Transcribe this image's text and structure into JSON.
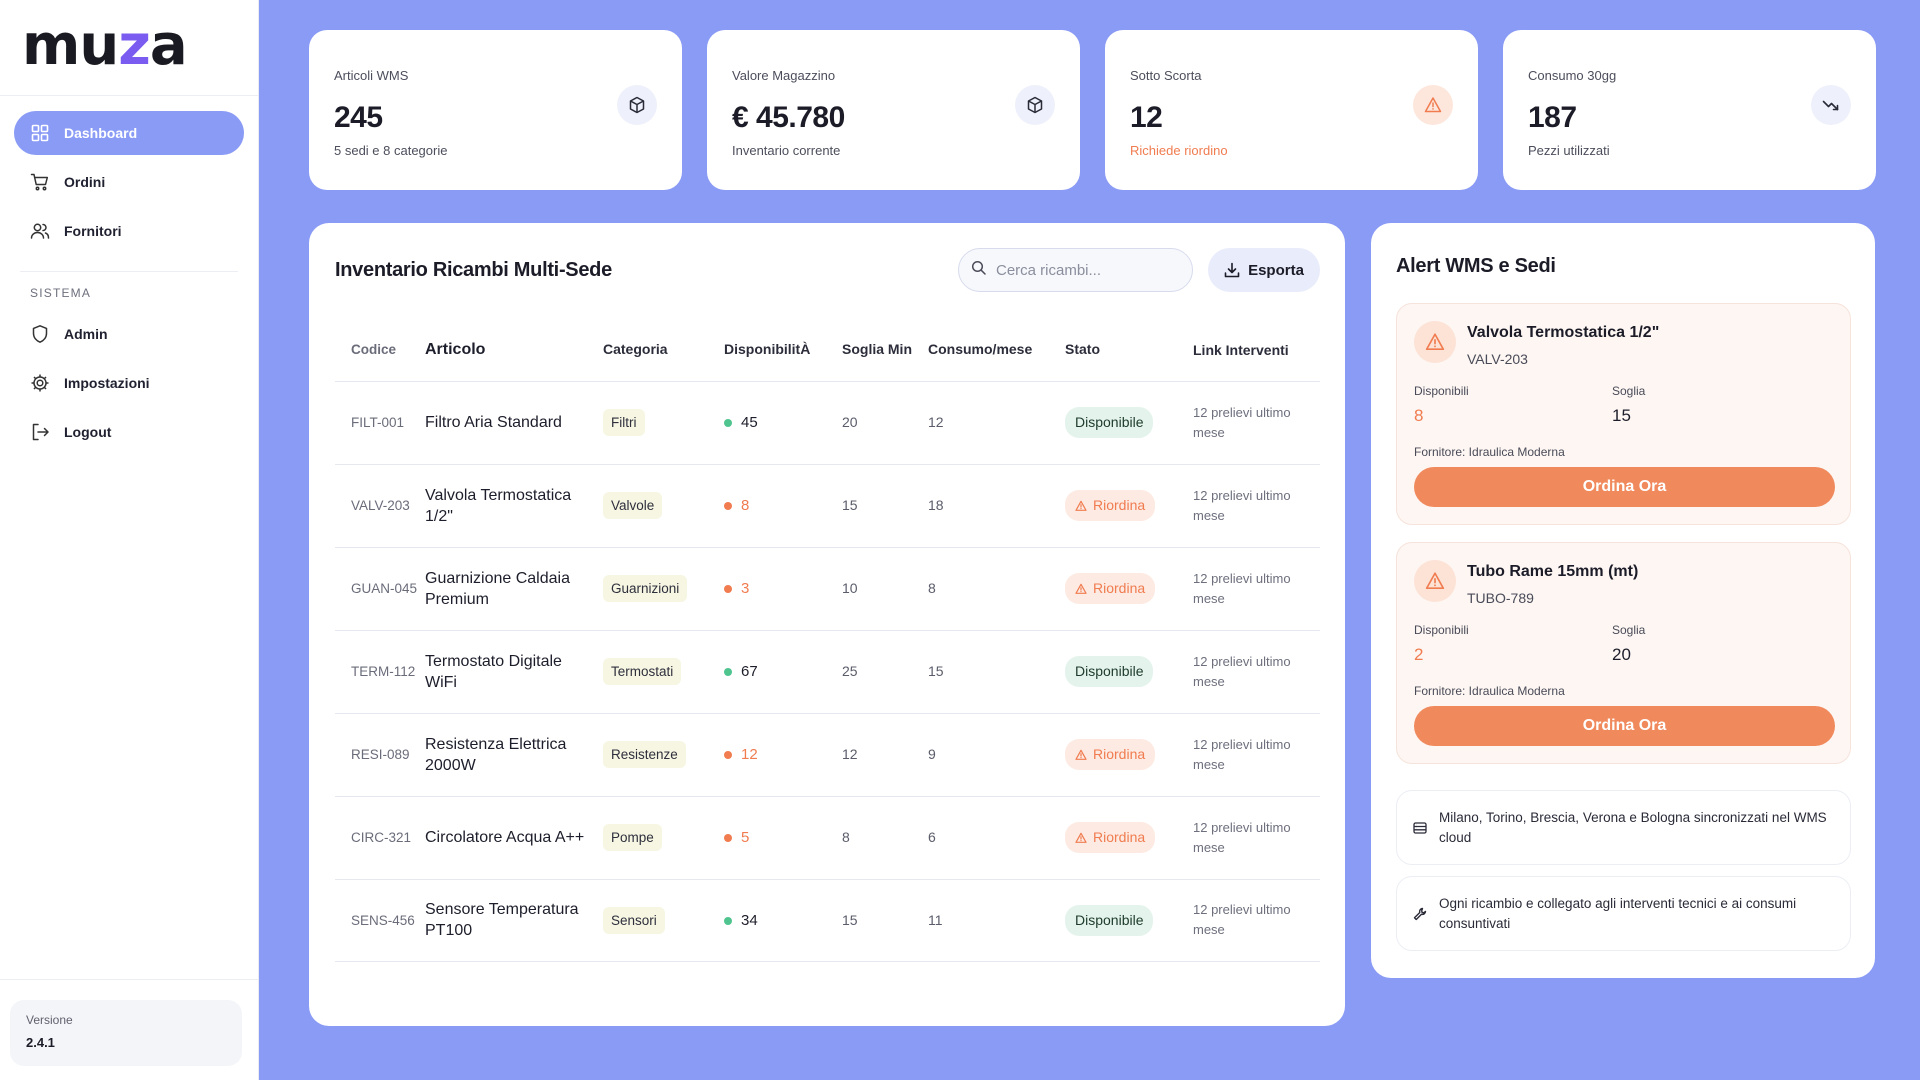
{
  "app": {
    "logo_left": "mu",
    "logo_z": "z",
    "logo_right": "a"
  },
  "sidebar": {
    "items": [
      {
        "label": "Dashboard",
        "icon": "grid-icon",
        "active": true
      },
      {
        "label": "Ordini",
        "icon": "cart-icon"
      },
      {
        "label": "Fornitori",
        "icon": "users-icon"
      }
    ],
    "section_label": "SISTEMA",
    "system_items": [
      {
        "label": "Admin",
        "icon": "shield-icon"
      },
      {
        "label": "Impostazioni",
        "icon": "gear-icon"
      },
      {
        "label": "Logout",
        "icon": "logout-icon"
      }
    ],
    "version_label": "Versione",
    "version_value": "2.4.1"
  },
  "stats": [
    {
      "label": "Articoli WMS",
      "value": "245",
      "sub": "5 sedi e 8 categorie",
      "icon": "box-icon"
    },
    {
      "label": "Valore Magazzino",
      "value": "€ 45.780",
      "sub": "Inventario corrente",
      "icon": "box-icon"
    },
    {
      "label": "Sotto Scorta",
      "value": "12",
      "sub": "Richiede riordino",
      "icon": "warning-icon"
    },
    {
      "label": "Consumo 30gg",
      "value": "187",
      "sub": "Pezzi utilizzati",
      "icon": "trend-down-icon"
    }
  ],
  "inventory": {
    "title": "Inventario Ricambi Multi-Sede",
    "search_placeholder": "Cerca ricambi...",
    "export_label": "Esporta",
    "columns": {
      "code": "Codice",
      "article": "Articolo",
      "category": "Categoria",
      "availability": "DisponibilitÀ",
      "min_threshold": "Soglia Min",
      "consumption": "Consumo/mese",
      "status": "Stato",
      "link": "Link Interventi"
    },
    "rows": [
      {
        "code": "FILT-001",
        "article": "Filtro Aria Standard",
        "category": "Filtri",
        "availability": "45",
        "min": "20",
        "consumption": "12",
        "status": "Disponibile",
        "level": "ok",
        "link": "12 prelievi ultimo mese"
      },
      {
        "code": "VALV-203",
        "article": "Valvola Termostatica 1/2\"",
        "category": "Valvole",
        "availability": "8",
        "min": "15",
        "consumption": "18",
        "status": "Riordina",
        "level": "low",
        "link": "12 prelievi ultimo mese"
      },
      {
        "code": "GUAN-045",
        "article": "Guarnizione Caldaia Premium",
        "category": "Guarnizioni",
        "availability": "3",
        "min": "10",
        "consumption": "8",
        "status": "Riordina",
        "level": "low",
        "link": "12 prelievi ultimo mese"
      },
      {
        "code": "TERM-112",
        "article": "Termostato Digitale WiFi",
        "category": "Termostati",
        "availability": "67",
        "min": "25",
        "consumption": "15",
        "status": "Disponibile",
        "level": "ok",
        "link": "12 prelievi ultimo mese"
      },
      {
        "code": "RESI-089",
        "article": "Resistenza Elettrica 2000W",
        "category": "Resistenze",
        "availability": "12",
        "min": "12",
        "consumption": "9",
        "status": "Riordina",
        "level": "low",
        "link": "12 prelievi ultimo mese"
      },
      {
        "code": "CIRC-321",
        "article": "Circolatore Acqua A++",
        "category": "Pompe",
        "availability": "5",
        "min": "8",
        "consumption": "6",
        "status": "Riordina",
        "level": "low",
        "link": "12 prelievi ultimo mese"
      },
      {
        "code": "SENS-456",
        "article": "Sensore Temperatura PT100",
        "category": "Sensori",
        "availability": "34",
        "min": "15",
        "consumption": "11",
        "status": "Disponibile",
        "level": "ok",
        "link": "12 prelievi ultimo mese"
      }
    ]
  },
  "alerts": {
    "title": "Alert WMS e Sedi",
    "items": [
      {
        "name": "Valvola Termostatica 1/2\"",
        "code": "VALV-203",
        "available_label": "Disponibili",
        "available": "8",
        "threshold_label": "Soglia",
        "threshold": "15",
        "supplier": "Fornitore: Idraulica Moderna",
        "button": "Ordina Ora"
      },
      {
        "name": "Tubo Rame 15mm (mt)",
        "code": "TUBO-789",
        "available_label": "Disponibili",
        "available": "2",
        "threshold_label": "Soglia",
        "threshold": "20",
        "supplier": "Fornitore: Idraulica Moderna",
        "button": "Ordina Ora"
      }
    ],
    "info": [
      {
        "text": "Milano, Torino, Brescia, Verona e Bologna sincronizzati nel WMS cloud",
        "icon": "database-icon"
      },
      {
        "text": "Ogni ricambio e collegato agli interventi tecnici e ai consumi consuntivati",
        "icon": "wrench-icon"
      }
    ]
  },
  "colors": {
    "background": "#8a9bf5",
    "accent": "#8a9bf5",
    "warning": "#f07c50",
    "ok": "#4fc48f",
    "order_button": "#f08a5d"
  }
}
